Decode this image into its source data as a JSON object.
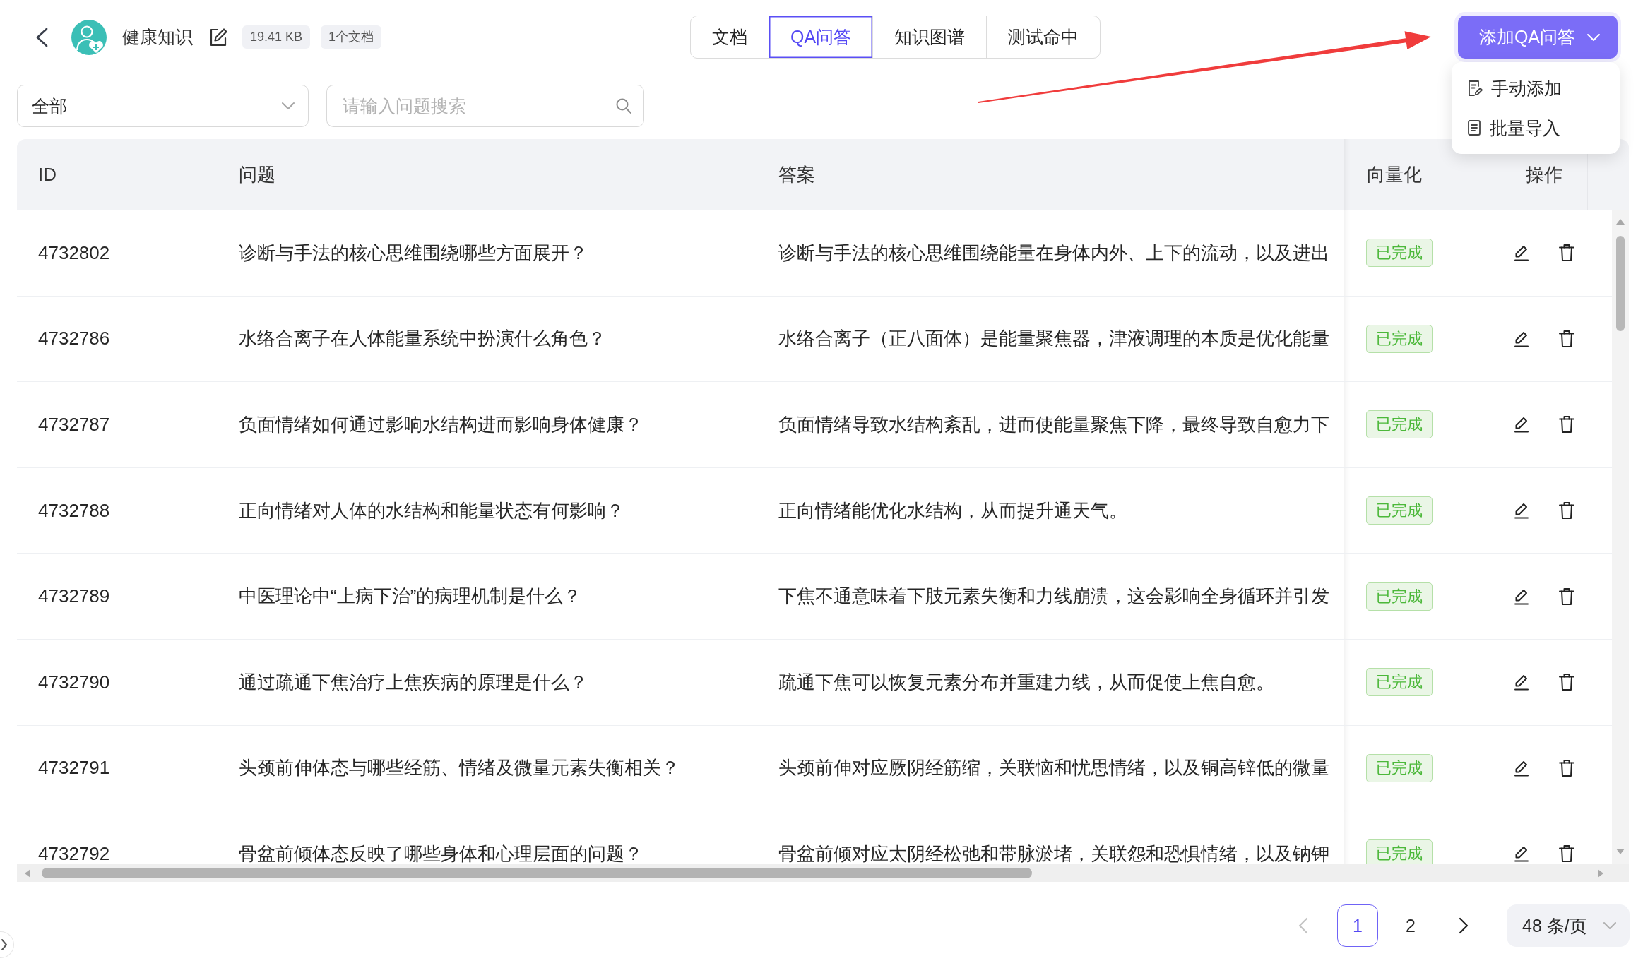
{
  "header": {
    "title": "健康知识",
    "file_size": "19.41 KB",
    "doc_count": "1个文档"
  },
  "tabs": [
    {
      "label": "文档",
      "selected": false
    },
    {
      "label": "QA问答",
      "selected": true
    },
    {
      "label": "知识图谱",
      "selected": false
    },
    {
      "label": "测试命中",
      "selected": false
    }
  ],
  "add_menu": {
    "label": "添加QA问答",
    "expanded": true,
    "items": [
      {
        "label": "手动添加",
        "kind": "manual"
      },
      {
        "label": "批量导入",
        "kind": "import"
      }
    ]
  },
  "filter": {
    "value": "全部"
  },
  "search": {
    "placeholder": "请输入问题搜索"
  },
  "table": {
    "columns": [
      "ID",
      "问题",
      "答案",
      "向量化",
      "操作"
    ],
    "rows": [
      {
        "id": "4732802",
        "question": "诊断与手法的核心思维围绕哪些方面展开？",
        "answer": "诊断与手法的核心思维围绕能量在身体内外、上下的流动，以及进出",
        "status": "已完成"
      },
      {
        "id": "4732786",
        "question": "水络合离子在人体能量系统中扮演什么角色？",
        "answer": "水络合离子（正八面体）是能量聚焦器，津液调理的本质是优化能量",
        "status": "已完成"
      },
      {
        "id": "4732787",
        "question": "负面情绪如何通过影响水结构进而影响身体健康？",
        "answer": "负面情绪导致水结构紊乱，进而使能量聚焦下降，最终导致自愈力下",
        "status": "已完成"
      },
      {
        "id": "4732788",
        "question": "正向情绪对人体的水结构和能量状态有何影响？",
        "answer": "正向情绪能优化水结构，从而提升通天气。",
        "status": "已完成"
      },
      {
        "id": "4732789",
        "question": "中医理论中“上病下治”的病理机制是什么？",
        "answer": "下焦不通意味着下肢元素失衡和力线崩溃，这会影响全身循环并引发",
        "status": "已完成"
      },
      {
        "id": "4732790",
        "question": "通过疏通下焦治疗上焦疾病的原理是什么？",
        "answer": "疏通下焦可以恢复元素分布并重建力线，从而促使上焦自愈。",
        "status": "已完成"
      },
      {
        "id": "4732791",
        "question": "头颈前伸体态与哪些经筋、情绪及微量元素失衡相关？",
        "answer": "头颈前伸对应厥阴经筋缩，关联恼和忧思情绪，以及铜高锌低的微量",
        "status": "已完成"
      },
      {
        "id": "4732792",
        "question": "骨盆前倾体态反映了哪些身体和心理层面的问题？",
        "answer": "骨盆前倾对应太阴经松弛和带脉淤堵，关联怨和恐惧情绪，以及钠钾",
        "status": "已完成"
      }
    ]
  },
  "pagination": {
    "prev": {
      "disabled": true
    },
    "pages": [
      {
        "label": "1",
        "selected": true
      },
      {
        "label": "2",
        "selected": false
      }
    ],
    "next": {
      "disabled": false
    },
    "page_size": "48 条/页"
  }
}
